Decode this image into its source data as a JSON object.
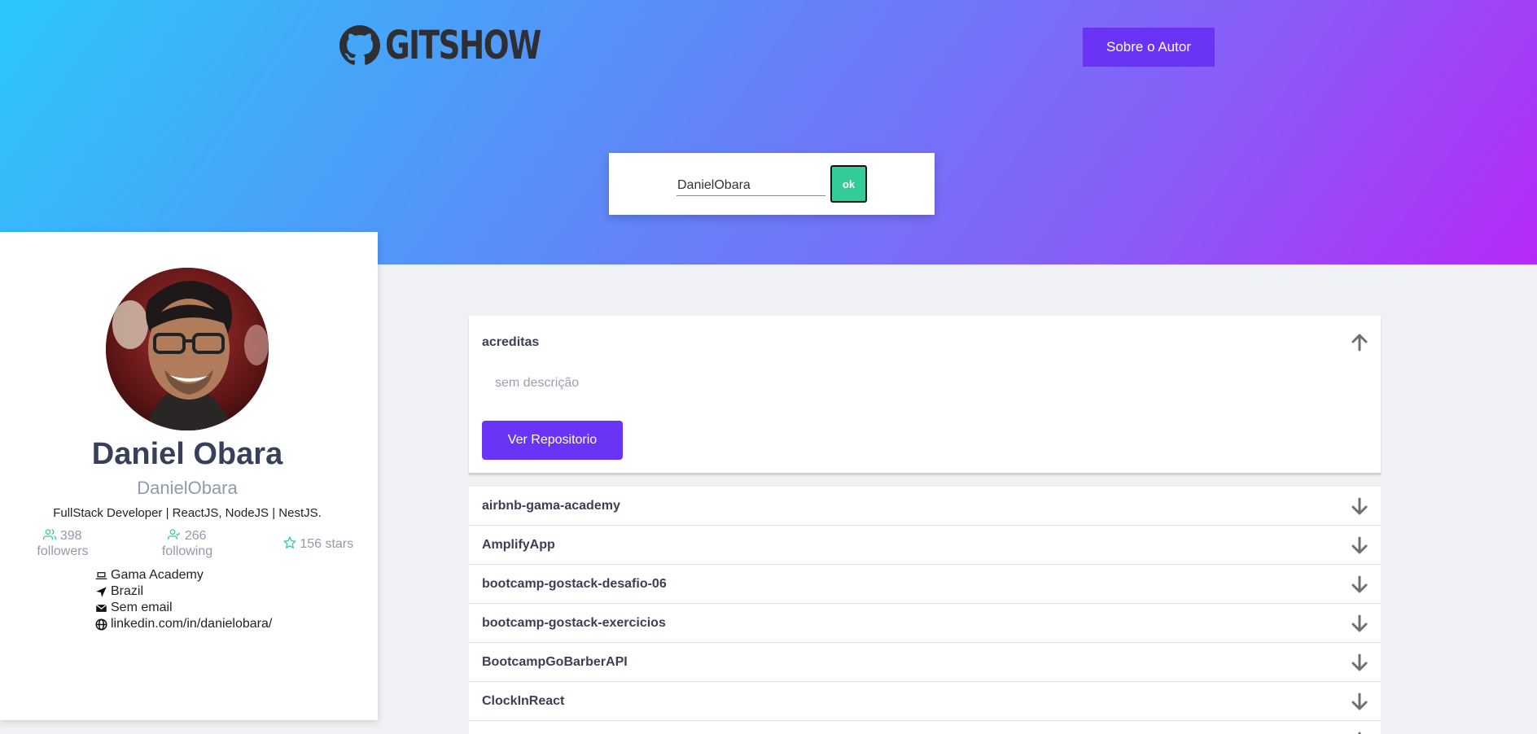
{
  "header": {
    "logo_text": "GITSHOW",
    "about_button": "Sobre o Autor"
  },
  "search": {
    "value": "DanielObara",
    "button_label": "ok"
  },
  "profile": {
    "name": "Daniel Obara",
    "login": "DanielObara",
    "bio": "FullStack Developer | ReactJS, NodeJS | NestJS.",
    "followers_count": "398",
    "followers_label": "followers",
    "following_count": "266",
    "following_label": "following",
    "stars": "156 stars",
    "company": "Gama Academy",
    "location": "Brazil",
    "email": "Sem email",
    "blog": "linkedin.com/in/danielobara/"
  },
  "repos": {
    "open": {
      "name": "acreditas",
      "description": "sem descrição",
      "button_label": "Ver Repositorio"
    },
    "collapsed": [
      {
        "name": "airbnb-gama-academy"
      },
      {
        "name": "AmplifyApp"
      },
      {
        "name": "bootcamp-gostack-desafio-06"
      },
      {
        "name": "bootcamp-gostack-exercicios"
      },
      {
        "name": "BootcampGoBarberAPI"
      },
      {
        "name": "ClockInReact"
      }
    ]
  },
  "colors": {
    "accent": "#6a34f7",
    "ok_button": "#33cc99",
    "stat_icon": "#33cc99"
  }
}
